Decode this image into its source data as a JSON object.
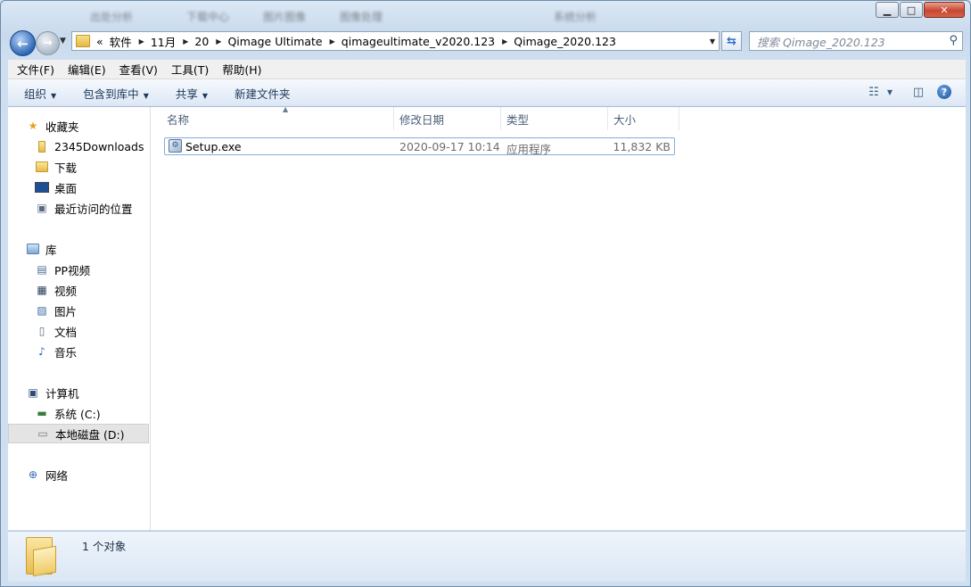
{
  "titlebar": {
    "blurred_items": [
      "出处分析",
      "下载中心",
      "图片图像",
      "图像处理",
      "系统分析"
    ]
  },
  "address": {
    "overflow": "«",
    "crumbs": [
      "软件",
      "11月",
      "20",
      "Qimage Ultimate",
      "qimageultimate_v2020.123",
      "Qimage_2020.123"
    ]
  },
  "search": {
    "placeholder": "搜索 Qimage_2020.123"
  },
  "menu": [
    "文件(F)",
    "编辑(E)",
    "查看(V)",
    "工具(T)",
    "帮助(H)"
  ],
  "toolbar": {
    "organize": "组织",
    "include_library": "包含到库中",
    "share": "共享",
    "new_folder": "新建文件夹"
  },
  "nav": {
    "favorites": "收藏夹",
    "favorites_items": [
      "2345Downloads",
      "下载",
      "桌面",
      "最近访问的位置"
    ],
    "libraries": "库",
    "library_items": [
      "PP视频",
      "视频",
      "图片",
      "文档",
      "音乐"
    ],
    "computer": "计算机",
    "drives": [
      "系统 (C:)",
      "本地磁盘 (D:)"
    ],
    "network": "网络"
  },
  "columns": {
    "name": "名称",
    "modified": "修改日期",
    "type": "类型",
    "size": "大小"
  },
  "files": [
    {
      "name": "Setup.exe",
      "modified": "2020-09-17 10:14",
      "type": "应用程序",
      "size": "11,832 KB"
    }
  ],
  "status": {
    "count_text": "1 个对象"
  },
  "colors": {
    "accent": "#2d67b8",
    "selection_border": "#84acdd",
    "chrome": "#cfdff0"
  }
}
